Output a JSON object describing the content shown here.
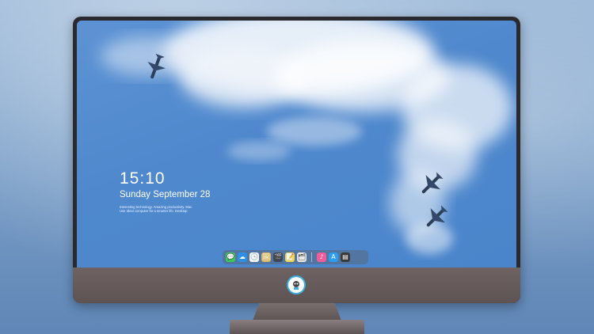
{
  "lock_screen": {
    "time": "15:10",
    "date": "Sunday September 28",
    "fine_print_line1": "Interesting technology. Amazing productivity. Mac",
    "fine_print_line2": "Use Ideal computer for a smarter life. Desktop"
  },
  "dock": {
    "items": [
      {
        "name": "messages",
        "icon": "message-bubble-icon",
        "glyph": "💬",
        "bg": "#3cc85a"
      },
      {
        "name": "finder",
        "icon": "cloud-icon",
        "glyph": "☁",
        "bg": "#2f8fe8"
      },
      {
        "name": "clock",
        "icon": "clock-icon",
        "glyph": "🕒",
        "bg": "#f5f5f5"
      },
      {
        "name": "preview",
        "icon": "photo-frame-icon",
        "glyph": "🖼",
        "bg": "#d7b86a"
      },
      {
        "name": "clapper",
        "icon": "clapper-icon",
        "glyph": "🎬",
        "bg": "#3b4a5a"
      },
      {
        "name": "notes",
        "icon": "note-icon",
        "glyph": "📝",
        "bg": "#f7d547"
      },
      {
        "name": "photos",
        "icon": "gallery-icon",
        "glyph": "🗂",
        "bg": "#e8e8e8"
      },
      {
        "name": "music",
        "icon": "music-note-icon",
        "glyph": "♪",
        "bg": "#f25c9a"
      },
      {
        "name": "app-store",
        "icon": "app-store-icon",
        "glyph": "A",
        "bg": "#2c9df0"
      },
      {
        "name": "terminal",
        "icon": "terminal-icon",
        "glyph": "▤",
        "bg": "#3a3a3a"
      }
    ]
  },
  "colors": {
    "sky": "#4f88cd",
    "bezel": "#2a2a2e",
    "chin": "#5e5353"
  }
}
